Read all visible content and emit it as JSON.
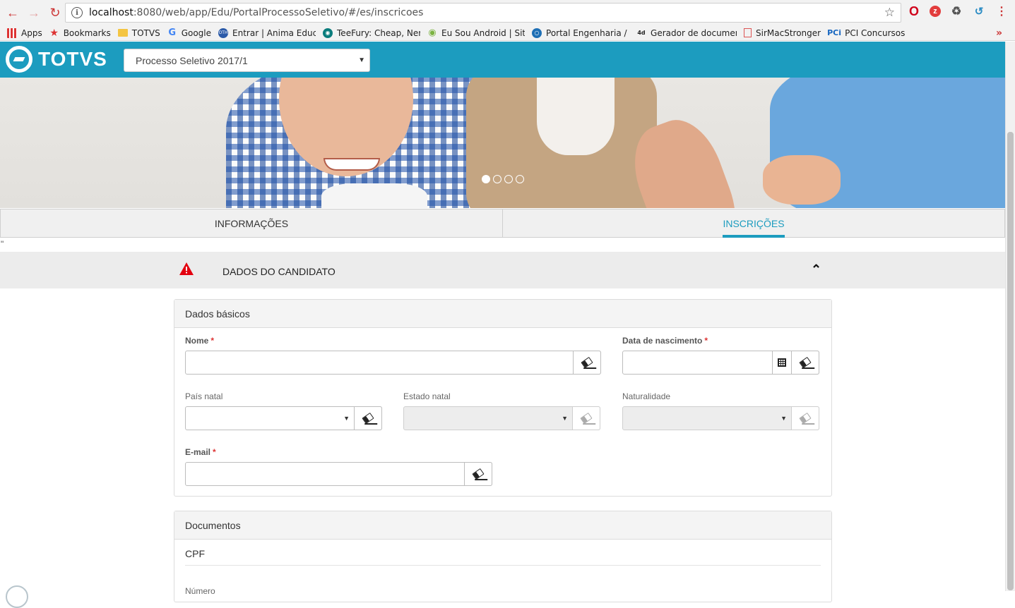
{
  "browser": {
    "url_host": "localhost",
    "url_path": ":8080/web/app/Edu/PortalProcessoSeletivo/#/es/inscricoes",
    "bookmarks": [
      {
        "label": "Apps",
        "icon": "apps-icon"
      },
      {
        "label": "Bookmarks",
        "icon": "star-icon"
      },
      {
        "label": "TOTVS",
        "icon": "folder-icon"
      },
      {
        "label": "Google",
        "icon": "google-icon"
      },
      {
        "label": "Entrar | Anima Educaç",
        "icon": "anima-icon"
      },
      {
        "label": "TeeFury: Cheap, Nerd",
        "icon": "teefury-icon"
      },
      {
        "label": "Eu Sou Android | Site",
        "icon": "android-icon"
      },
      {
        "label": "Portal Engenharia / A",
        "icon": "portal-icon"
      },
      {
        "label": "Gerador de document",
        "icon": "4devs-icon"
      },
      {
        "label": "SirMacStronger",
        "icon": "document-icon"
      },
      {
        "label": "PCI Concursos",
        "icon": "pci-icon"
      }
    ],
    "more_label": "»"
  },
  "header": {
    "logo_text": "TOTVS",
    "process_select_value": "Processo Seletivo 2017/1"
  },
  "carousel": {
    "slide_count": 4,
    "active_index": 0
  },
  "tabs": [
    {
      "label": "INFORMAÇÕES",
      "active": false
    },
    {
      "label": "INSCRIÇÕES",
      "active": true
    }
  ],
  "stray_text": "\"",
  "section": {
    "title": "DADOS DO CANDIDATO",
    "warning_color": "#e3000f"
  },
  "dados_basicos": {
    "title": "Dados básicos",
    "nome_label": "Nome",
    "nascimento_label": "Data de nascimento",
    "pais_label": "País natal",
    "estado_label": "Estado natal",
    "naturalidade_label": "Naturalidade",
    "email_label": "E-mail",
    "required_mark": "*"
  },
  "documentos": {
    "title": "Documentos",
    "cpf_label": "CPF",
    "numero_label": "Número"
  },
  "colors": {
    "brand": "#1c9cbf",
    "required": "#dd3333"
  }
}
